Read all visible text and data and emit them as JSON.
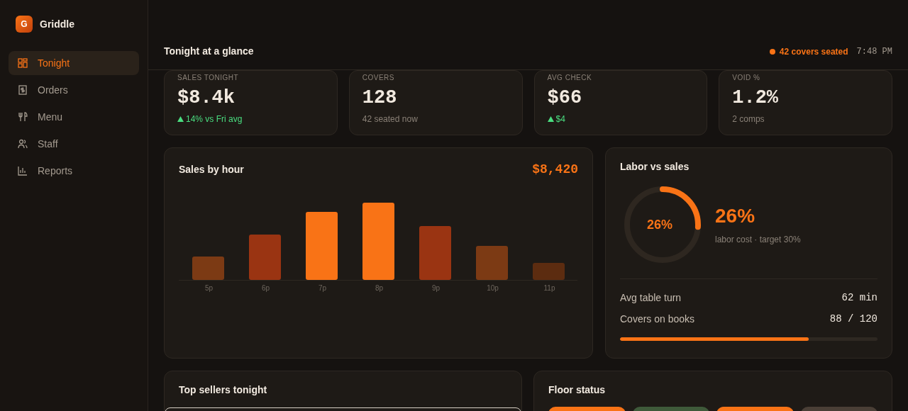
{
  "brand": {
    "initial": "G",
    "name": "Griddle"
  },
  "sidebar": {
    "items": [
      {
        "label": "Tonight",
        "kind": "grid",
        "selected": true
      },
      {
        "label": "Orders",
        "kind": "receipt",
        "selected": false
      },
      {
        "label": "Menu",
        "kind": "utensils",
        "selected": false
      },
      {
        "label": "Staff",
        "kind": "people",
        "selected": false
      },
      {
        "label": "Reports",
        "kind": "chart",
        "selected": false
      }
    ]
  },
  "header": {
    "title": "Tonight at a glance",
    "status": "42 covers seated",
    "time": "7:48 PM"
  },
  "stats": [
    {
      "label": "SALES TONIGHT",
      "value": "$8.4k",
      "note": "14% vs Fri avg",
      "kind": "up"
    },
    {
      "label": "COVERS",
      "value": "128",
      "note": "42 seated now",
      "kind": "plain"
    },
    {
      "label": "AVG CHECK",
      "value": "$66",
      "note": "$4",
      "kind": "up"
    },
    {
      "label": "VOID %",
      "value": "1.2%",
      "note": "2 comps",
      "kind": "plain"
    }
  ],
  "sales_chart": {
    "title": "Sales by hour",
    "total": "$8,420",
    "hours": [
      "5p",
      "6p",
      "7p",
      "8p",
      "9p",
      "10p",
      "11p"
    ]
  },
  "labor": {
    "title": "Labor vs sales",
    "ring_label": "26%",
    "level": 0.26,
    "value": "26%",
    "caption": "labor cost · target 30%",
    "rows": [
      {
        "label": "Avg table turn",
        "value": "62 min"
      },
      {
        "label": "Covers on books",
        "value": "88 / 120"
      }
    ],
    "books": {
      "level": 0.733
    }
  },
  "top_sellers": {
    "title": "Top sellers tonight"
  },
  "floor": {
    "title": "Floor status",
    "tiles": [
      {
        "color": "#f97316"
      },
      {
        "color": "#3f5a3a"
      },
      {
        "color": "#f97316"
      },
      {
        "color": "#4a3f36"
      }
    ]
  }
}
